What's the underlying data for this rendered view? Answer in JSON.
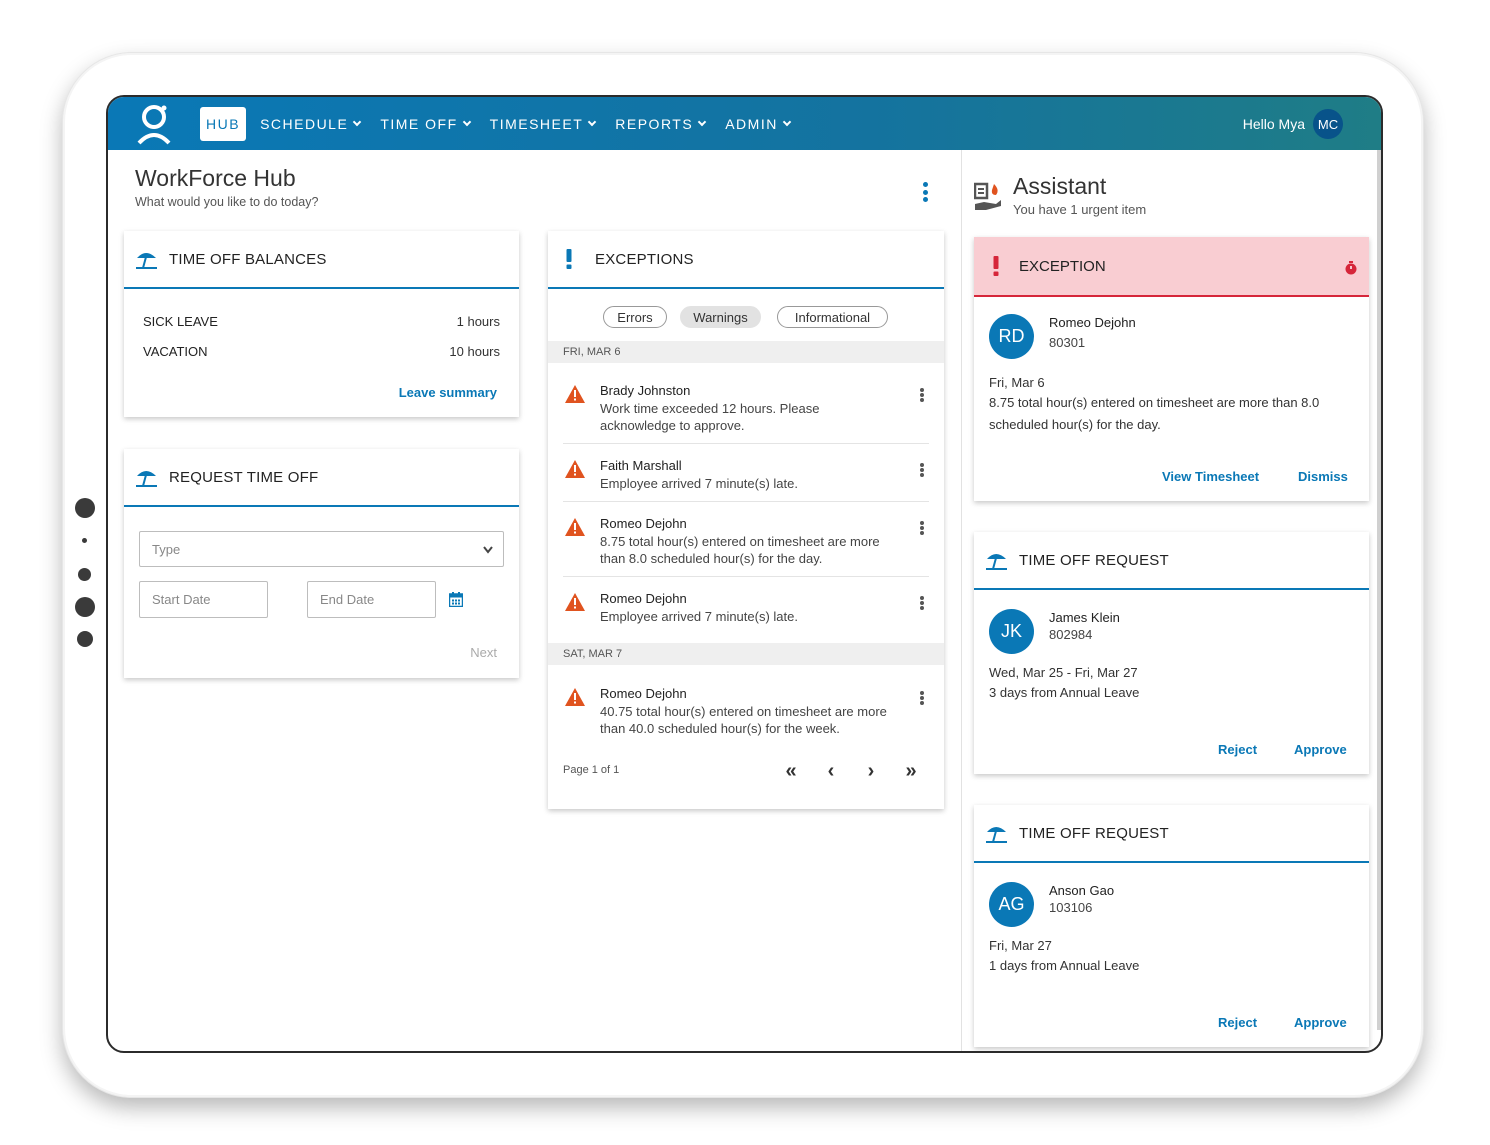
{
  "nav": {
    "items": [
      {
        "label": "HUB",
        "active": true
      },
      {
        "label": "SCHEDULE",
        "active": false
      },
      {
        "label": "TIME OFF",
        "active": false
      },
      {
        "label": "TIMESHEET",
        "active": false
      },
      {
        "label": "REPORTS",
        "active": false
      },
      {
        "label": "ADMIN",
        "active": false
      }
    ],
    "greeting": "Hello Mya",
    "user_initials": "MC"
  },
  "page": {
    "title": "WorkForce Hub",
    "subtitle": "What would you like to do today?"
  },
  "balances": {
    "heading": "TIME OFF BALANCES",
    "rows": [
      {
        "label": "SICK LEAVE",
        "value": "1 hours"
      },
      {
        "label": "VACATION",
        "value": "10 hours"
      }
    ],
    "link": "Leave summary"
  },
  "request": {
    "heading": "REQUEST TIME OFF",
    "type_placeholder": "Type",
    "start_placeholder": "Start Date",
    "end_placeholder": "End Date",
    "next_label": "Next"
  },
  "exceptions": {
    "heading": "EXCEPTIONS",
    "filters": [
      "Errors",
      "Warnings",
      "Informational"
    ],
    "selected_filter": "Warnings",
    "groups": [
      {
        "date": "FRI, MAR 6",
        "items": [
          {
            "name": "Brady Johnston",
            "message": "Work time exceeded 12 hours. Please acknowledge to approve."
          },
          {
            "name": "Faith Marshall",
            "message": "Employee arrived 7 minute(s) late."
          },
          {
            "name": "Romeo Dejohn",
            "message": "8.75 total hour(s) entered on timesheet are more than 8.0 scheduled hour(s) for the day."
          },
          {
            "name": "Romeo Dejohn",
            "message": "Employee arrived 7 minute(s) late."
          }
        ]
      },
      {
        "date": "SAT, MAR 7",
        "items": [
          {
            "name": "Romeo Dejohn",
            "message": "40.75 total hour(s) entered on timesheet are more than 40.0 scheduled hour(s) for the week."
          }
        ]
      }
    ],
    "pagination": "Page 1 of 1"
  },
  "assistant": {
    "title": "Assistant",
    "subtitle": "You have 1 urgent item",
    "exception_card": {
      "heading": "EXCEPTION",
      "initials": "RD",
      "name": "Romeo Dejohn",
      "id": "80301",
      "date": "Fri, Mar 6",
      "message": "8.75 total hour(s) entered on timesheet are more than 8.0 scheduled hour(s) for the day.",
      "primary_action": "View Timesheet",
      "secondary_action": "Dismiss"
    },
    "requests": [
      {
        "heading": "TIME OFF REQUEST",
        "initials": "JK",
        "name": "James Klein",
        "id": "802984",
        "dates": "Wed, Mar 25 - Fri, Mar 27",
        "detail": "3 days from Annual Leave",
        "reject": "Reject",
        "approve": "Approve"
      },
      {
        "heading": "TIME OFF REQUEST",
        "initials": "AG",
        "name": "Anson Gao",
        "id": "103106",
        "dates": "Fri, Mar 27",
        "detail": "1 days from Annual Leave",
        "reject": "Reject",
        "approve": "Approve"
      }
    ]
  },
  "colors": {
    "brand": "#0a78b6",
    "warning": "#e0531f",
    "exception_bg": "#f9cdd2",
    "exception_accent": "#d6263a"
  },
  "icons": [
    "person-logo-icon",
    "chevron-down-icon",
    "kebab-menu-icon",
    "umbrella-icon",
    "exclamation-icon",
    "warning-triangle-icon",
    "calendar-icon",
    "first-page-icon",
    "prev-page-icon",
    "next-page-icon",
    "last-page-icon",
    "assistant-icon",
    "timer-icon"
  ]
}
